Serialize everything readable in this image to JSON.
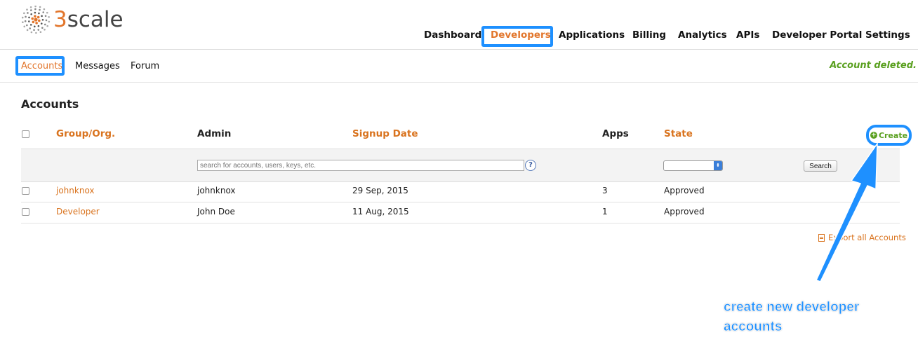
{
  "brand": {
    "name_prefix": "3",
    "name_rest": "scale"
  },
  "top_nav": {
    "items": [
      {
        "label": "Dashboard",
        "active": false
      },
      {
        "label": "Developers",
        "active": true
      },
      {
        "label": "Applications",
        "active": false
      },
      {
        "label": "Billing",
        "active": false
      },
      {
        "label": "Analytics",
        "active": false
      },
      {
        "label": "APIs",
        "active": false
      },
      {
        "label": "Developer Portal",
        "active": false
      },
      {
        "label": "Settings",
        "active": false
      }
    ]
  },
  "sub_nav": {
    "items": [
      {
        "label": "Accounts",
        "active": true
      },
      {
        "label": "Messages",
        "active": false
      },
      {
        "label": "Forum",
        "active": false
      }
    ],
    "flash": "Account deleted."
  },
  "main": {
    "title": "Accounts",
    "columns": [
      "Group/Org.",
      "Admin",
      "Signup Date",
      "Apps",
      "State"
    ],
    "create_label": "Create",
    "filter": {
      "search_placeholder": "search for accounts, users, keys, etc.",
      "help_glyph": "?",
      "state_value": "",
      "search_button": "Search"
    },
    "rows": [
      {
        "group": "johnknox",
        "admin": "johnknox",
        "signup": "29 Sep, 2015",
        "apps": "3",
        "state": "Approved"
      },
      {
        "group": "Developer",
        "admin": "John Doe",
        "signup": "11 Aug, 2015",
        "apps": "1",
        "state": "Approved"
      }
    ],
    "export_label": "Export all Accounts"
  },
  "annotation": {
    "line1": "create new developer",
    "line2": "accounts"
  },
  "colors": {
    "accent": "#e2762c",
    "highlight": "#1e90ff",
    "success": "#5aa020"
  }
}
